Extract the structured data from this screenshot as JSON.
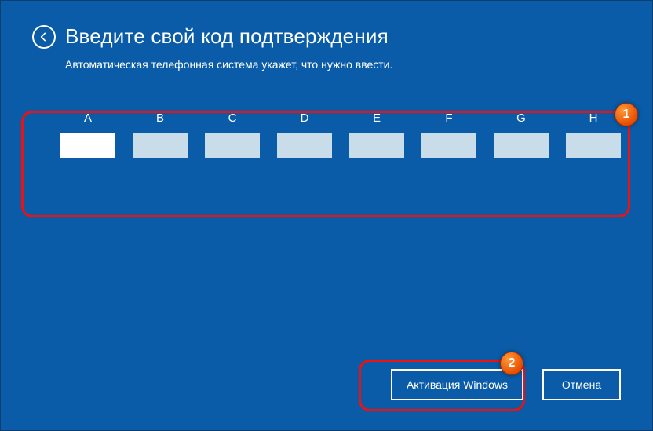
{
  "header": {
    "title": "Введите свой код подтверждения",
    "subtitle": "Автоматическая телефонная система укажет, что нужно ввести."
  },
  "code": {
    "columns": [
      "A",
      "B",
      "C",
      "D",
      "E",
      "F",
      "G",
      "H"
    ],
    "values": [
      "",
      "",
      "",
      "",
      "",
      "",
      "",
      ""
    ],
    "focused_index": 0
  },
  "buttons": {
    "activate": "Активация Windows",
    "cancel": "Отмена"
  },
  "callouts": {
    "one": "1",
    "two": "2"
  },
  "colors": {
    "background": "#0a5ca8",
    "highlight": "#ef1010",
    "input_bg": "#c8dce9",
    "input_focus_bg": "#ffffff",
    "text": "#ffffff"
  }
}
